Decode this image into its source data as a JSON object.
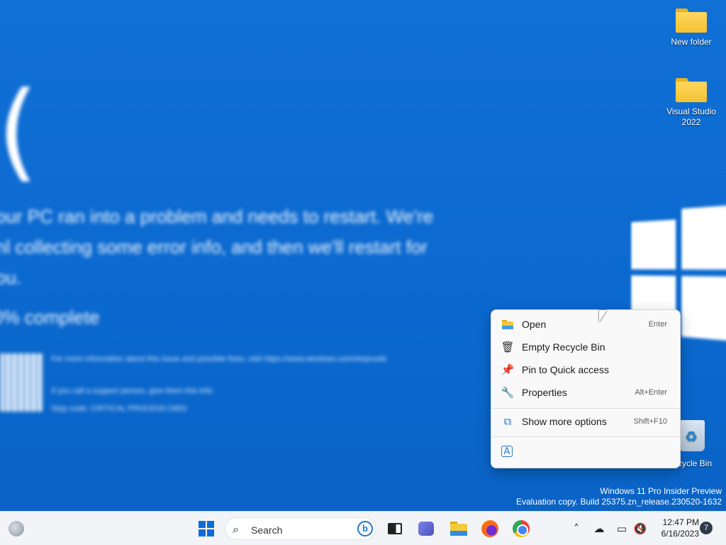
{
  "desktop": {
    "icons": [
      {
        "label": "New folder"
      },
      {
        "label": "Visual Studio 2022"
      },
      {
        "label": "cycle Bin"
      }
    ],
    "wallpaper": {
      "face": "(",
      "message": "our PC ran into a problem and needs to restart. We're\nnl collecting some error info, and then we'll restart for\nou.",
      "progress": "0% complete",
      "small_1": "For more information about this issue and possible fixes, visit https://www.windows.com/stopcode",
      "small_2": "If you call a support person, give them this info:",
      "small_3": "Stop code: CRITICAL PROCESS DIED"
    },
    "watermark": {
      "line1": "Windows 11 Pro Insider Preview",
      "line2": "Evaluation copy. Build 25375.zn_release.230520-1632"
    }
  },
  "context_menu": {
    "items": [
      {
        "label": "Open",
        "shortcut": "Enter",
        "icon": "folder-icon"
      },
      {
        "label": "Empty Recycle Bin",
        "shortcut": "",
        "icon": "trash-icon"
      },
      {
        "label": "Pin to Quick access",
        "shortcut": "",
        "icon": "pin-icon"
      },
      {
        "label": "Properties",
        "shortcut": "Alt+Enter",
        "icon": "wrench-icon"
      },
      {
        "label": "Show more options",
        "shortcut": "Shift+F10",
        "icon": "external-icon"
      }
    ],
    "extra_icon": "translate-icon"
  },
  "taskbar": {
    "search_label": "Search",
    "bing_label": "b",
    "time": "12:47 PM",
    "date": "6/16/2023",
    "notification_count": "7",
    "colors": {
      "accent": "#0f6cd8",
      "background": "#f2f4f7"
    }
  }
}
